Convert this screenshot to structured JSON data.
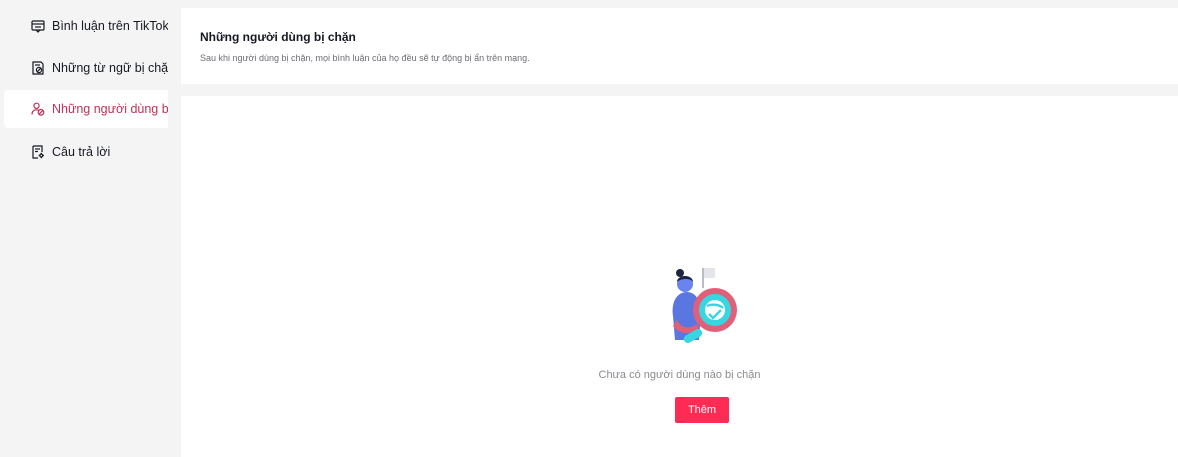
{
  "sidebar": {
    "items": [
      {
        "label": "Bình luận trên TikTok",
        "icon": "comment-window-icon",
        "active": false
      },
      {
        "label": "Những từ ngữ bị chặn",
        "icon": "blocked-words-icon",
        "active": false
      },
      {
        "label": "Những người dùng bị chặn",
        "icon": "blocked-user-icon",
        "active": true
      },
      {
        "label": "Câu trả lời",
        "icon": "reply-doc-icon",
        "active": false
      }
    ]
  },
  "header": {
    "title": "Những người dùng bị chặn",
    "description": "Sau khi người dùng bị chặn, mọi bình luận của họ đều sẽ tự động bị ẩn trên mạng."
  },
  "empty_state": {
    "illustration": "person-magnifier-illustration",
    "message": "Chưa có người dùng nào bị chặn",
    "add_label": "Thêm"
  },
  "colors": {
    "accent": "#fe2c55",
    "active_text": "#c13157",
    "background": "#f4f4f5",
    "card": "#ffffff"
  }
}
